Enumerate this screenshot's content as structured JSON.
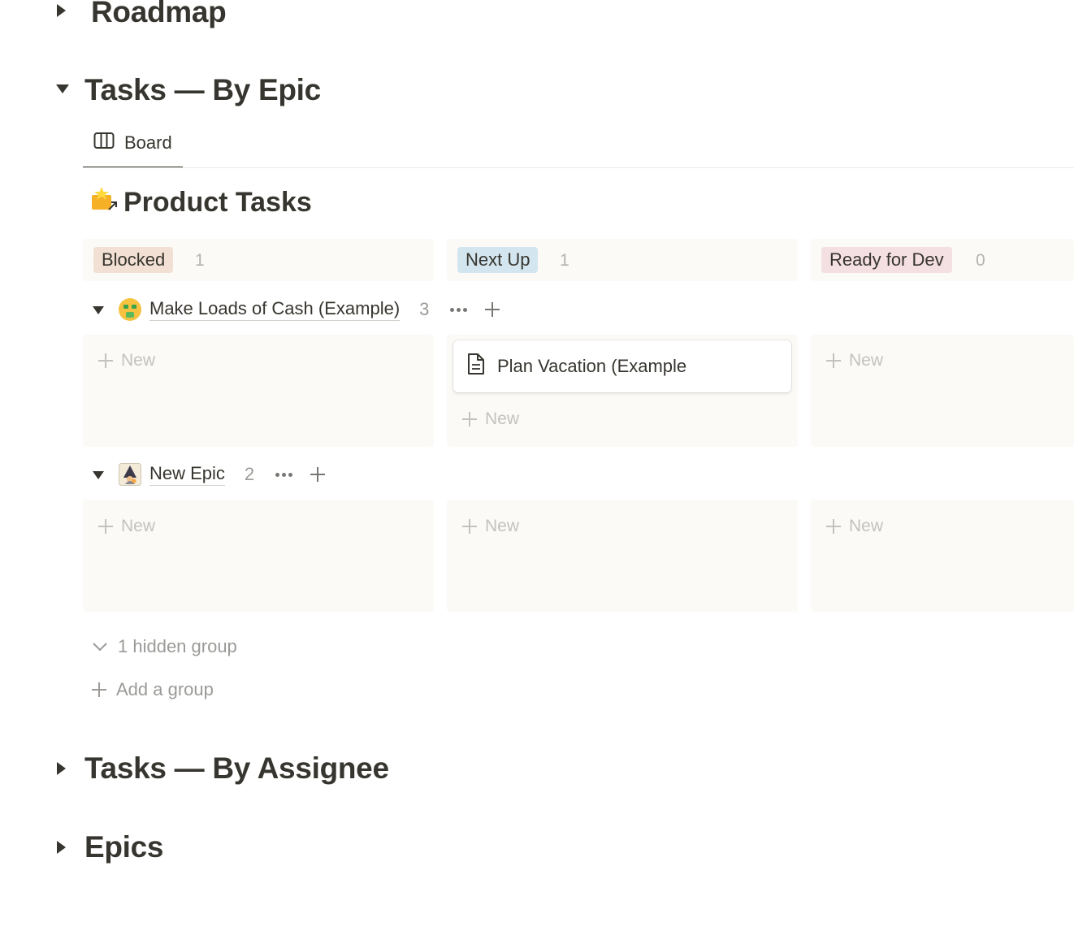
{
  "sections": {
    "roadmap": {
      "title": "Roadmap"
    },
    "tasks_by_epic": {
      "title": "Tasks — By Epic"
    },
    "tasks_by_assignee": {
      "title": "Tasks — By Assignee"
    },
    "epics": {
      "title": "Epics"
    }
  },
  "view": {
    "tab_label": "Board",
    "tab_icon": "board-icon"
  },
  "database": {
    "title": "Product Tasks",
    "icon": "star-box-icon"
  },
  "columns": [
    {
      "label": "Blocked",
      "count": "1",
      "color": "#f1e0d3"
    },
    {
      "label": "Next Up",
      "count": "1",
      "color": "#d3e5ef"
    },
    {
      "label": "Ready for Dev",
      "count": "0",
      "color": "#f4dfe2"
    }
  ],
  "groups": [
    {
      "label": "Make Loads of Cash (Example)",
      "count": "3",
      "icon": "money-mouth-face-icon"
    },
    {
      "label": "New Epic",
      "count": "2",
      "icon": "wizard-icon"
    }
  ],
  "cards": [
    {
      "title": "Plan Vacation (Example",
      "icon": "page-icon"
    }
  ],
  "new_label": "New",
  "hidden_groups_label": "1 hidden group",
  "add_group_label": "Add a group"
}
